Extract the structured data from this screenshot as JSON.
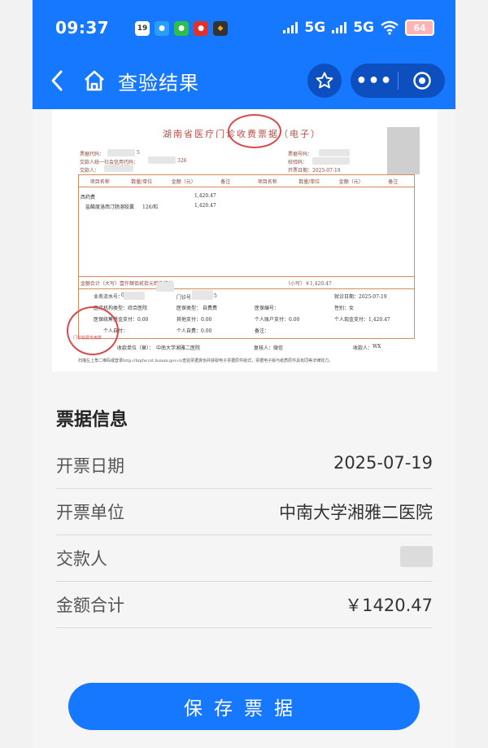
{
  "status_bar": {
    "time": "09:37",
    "net1": "5G",
    "net2": "5G",
    "battery": "64",
    "date_badge": "19"
  },
  "nav": {
    "title": "查验结果"
  },
  "receipt": {
    "title": "湖南省医疗门诊收费票据（电子）",
    "meta_left": [
      "票据代码：",
      "交款人统一社会信用代码：",
      "交款人："
    ],
    "meta_left_partial": [
      "5",
      "326"
    ],
    "meta_right": [
      "票据号码：",
      "校验码：",
      "开票日期：2025-07-19"
    ],
    "columns": [
      "项目名称",
      "数量/单位",
      "金额（元）",
      "备注",
      "项目名称",
      "数量/单位",
      "金额（元）",
      "备注"
    ],
    "item1": {
      "name": "西药费",
      "amount": "1,420.47"
    },
    "item2": {
      "name": "盐酸度洛西汀肠溶胶囊",
      "qty": "126/粒",
      "amount": "1,420.47"
    },
    "sum_label": "金额合计（大写）壹仟肆佰贰拾元肆角柒分",
    "sum_small": "（小写）￥1,420.47",
    "details": [
      "业务流水号：",
      "门诊号：",
      "就诊日期：2025-07-19",
      "医疗机构类型：综合医院",
      "医保类型：",
      "自费费",
      "医保编号：",
      "性别：女",
      "医保统筹基金支付：0.00",
      "其他支付：0.00",
      "个人账户支付：0.00",
      "个人现金支付：1,420.47",
      "个人自付：",
      "个人自费：0.00",
      "备注："
    ],
    "detail_partials": [
      "07",
      "32",
      "5"
    ],
    "issuer_label": "收款单位（章）：",
    "issuer": "中南大学湘雅二医院",
    "reviewer": "复核人：",
    "reviewer_val": "微信",
    "payee": "收款人：",
    "payee_val": "WX",
    "footer": "扫描左上角二维码或登录http://hnjfw.czt.hunan.gov.cn查验票据真伪并获取电子票据原件版式，票据电子版与纸质原件具有同等法律效力。",
    "seal_bottom_text": "门诊收费专用章"
  },
  "info": {
    "title": "票据信息",
    "rows": [
      {
        "label": "开票日期",
        "value": "2025-07-19"
      },
      {
        "label": "开票单位",
        "value": "中南大学湘雅二医院"
      },
      {
        "label": "交款人",
        "value": ""
      },
      {
        "label": "金额合计",
        "value": "￥1420.47"
      }
    ]
  },
  "save_button": "保存票据",
  "colors": {
    "primary": "#1677ff",
    "stamp": "#d94a4a"
  }
}
